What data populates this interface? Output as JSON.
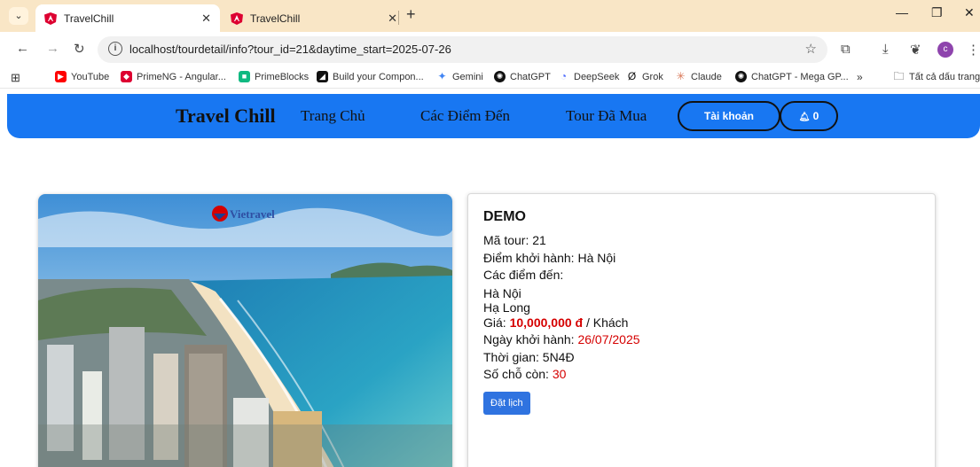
{
  "browser": {
    "tabs": [
      {
        "title": "TravelChill",
        "active": true
      },
      {
        "title": "TravelChill",
        "active": false
      }
    ],
    "url": "localhost/tourdetail/info?tour_id=21&daytime_start=2025-07-26",
    "profile_initial": "c",
    "bookmarks": [
      {
        "label": "YouTube",
        "icon": "youtube-icon",
        "color": "#ff0000"
      },
      {
        "label": "PrimeNG - Angular...",
        "icon": "primeng-icon",
        "color": "#dd0031"
      },
      {
        "label": "PrimeBlocks",
        "icon": "primeblocks-icon",
        "color": "#10b981"
      },
      {
        "label": "Build your Compon...",
        "icon": "build-icon",
        "color": "#111111"
      },
      {
        "label": "Gemini",
        "icon": "gemini-icon",
        "color": "#4285f4"
      },
      {
        "label": "ChatGPT",
        "icon": "chatgpt-icon",
        "color": "#111111"
      },
      {
        "label": "DeepSeek",
        "icon": "deepseek-icon",
        "color": "#4d6bfe"
      },
      {
        "label": "Grok",
        "icon": "grok-icon",
        "color": "#111111"
      },
      {
        "label": "Claude",
        "icon": "claude-icon",
        "color": "#d97757"
      },
      {
        "label": "ChatGPT - Mega GP...",
        "icon": "chatgpt-icon",
        "color": "#111111"
      }
    ],
    "all_bookmarks_label": "Tất cả dấu trang"
  },
  "site": {
    "brand": "Travel Chill",
    "nav": [
      "Trang Chủ",
      "Các Điểm Đến",
      "Tour Đã Mua"
    ],
    "account_label": "Tài khoản",
    "notification_count": "0",
    "accent_color": "#1877f2"
  },
  "tour": {
    "image_logo": "Vietravel",
    "name": "DEMO",
    "code_label": "Mã tour:",
    "code": "21",
    "departure_label": "Điểm khởi hành:",
    "departure": "Hà Nội",
    "destinations_label": "Các điểm đến:",
    "destinations": [
      "Hà Nội",
      "Hạ Long"
    ],
    "price_label": "Giá:",
    "price": "10,000,000 đ",
    "price_unit": "/ Khách",
    "start_date_label": "Ngày khởi hành:",
    "start_date": "26/07/2025",
    "duration_label": "Thời gian:",
    "duration": "5N4Đ",
    "seats_label": "Số chỗ còn:",
    "seats": "30",
    "book_button": "Đặt lịch"
  }
}
